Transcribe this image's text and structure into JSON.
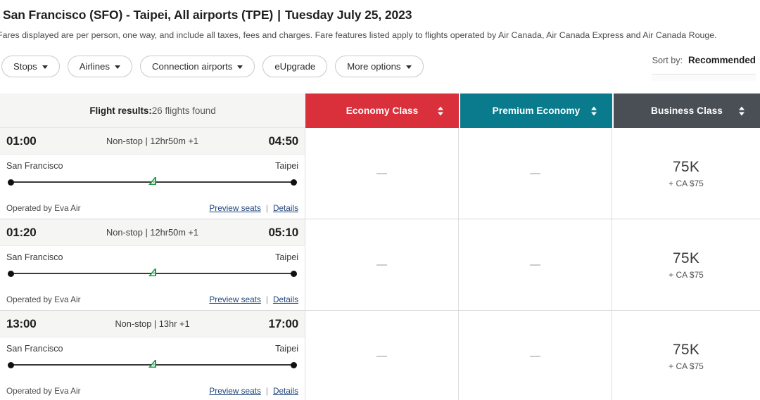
{
  "header": {
    "origin": "San Francisco (SFO) - Taipei, All airports (TPE)",
    "separator": "|",
    "date": "Tuesday July 25, 2023",
    "fare_note": "Fares displayed are per person, one way, and include all taxes, fees and charges. Fare features listed apply to flights operated by Air Canada, Air Canada Express and Air Canada Rouge."
  },
  "filters": [
    {
      "label": "Stops",
      "has_caret": true
    },
    {
      "label": "Airlines",
      "has_caret": true
    },
    {
      "label": "Connection airports",
      "has_caret": true
    },
    {
      "label": "eUpgrade",
      "has_caret": false
    },
    {
      "label": "More options",
      "has_caret": true
    }
  ],
  "sort": {
    "label": "Sort by:",
    "value": "Recommended"
  },
  "results_header": {
    "title": "Flight results:",
    "count_text": "26 flights found"
  },
  "cabins": [
    {
      "label": "Economy Class",
      "color": "#d9303c",
      "sort_icon": "sort-updown-icon"
    },
    {
      "label": "Premium Economy",
      "color": "#0a7b8c",
      "sort_icon": "sort-updown-icon"
    },
    {
      "label": "Business Class",
      "color": "#4a4f55",
      "sort_icon": "sort-updown-icon"
    }
  ],
  "flights": [
    {
      "depart_time": "01:00",
      "arrive_time": "04:50",
      "stops": "Non-stop | 12hr50m +1",
      "origin_city": "San Francisco",
      "destination_city": "Taipei",
      "operated_by": "Operated by Eva Air",
      "preview_seats": "Preview seats",
      "link_divider": "|",
      "details": "Details",
      "economy": {
        "available": false,
        "main": "—",
        "sub": ""
      },
      "premium": {
        "available": false,
        "main": "—",
        "sub": ""
      },
      "business": {
        "available": true,
        "main": "75K",
        "sub": "+ CA $75"
      }
    },
    {
      "depart_time": "01:20",
      "arrive_time": "05:10",
      "stops": "Non-stop | 12hr50m +1",
      "origin_city": "San Francisco",
      "destination_city": "Taipei",
      "operated_by": "Operated by Eva Air",
      "preview_seats": "Preview seats",
      "link_divider": "|",
      "details": "Details",
      "economy": {
        "available": false,
        "main": "—",
        "sub": ""
      },
      "premium": {
        "available": false,
        "main": "—",
        "sub": ""
      },
      "business": {
        "available": true,
        "main": "75K",
        "sub": "+ CA $75"
      }
    },
    {
      "depart_time": "13:00",
      "arrive_time": "17:00",
      "stops": "Non-stop | 13hr +1",
      "origin_city": "San Francisco",
      "destination_city": "Taipei",
      "operated_by": "Operated by Eva Air",
      "preview_seats": "Preview seats",
      "link_divider": "|",
      "details": "Details",
      "economy": {
        "available": false,
        "main": "—",
        "sub": ""
      },
      "premium": {
        "available": false,
        "main": "—",
        "sub": ""
      },
      "business": {
        "available": true,
        "main": "75K",
        "sub": "+ CA $75"
      }
    }
  ]
}
